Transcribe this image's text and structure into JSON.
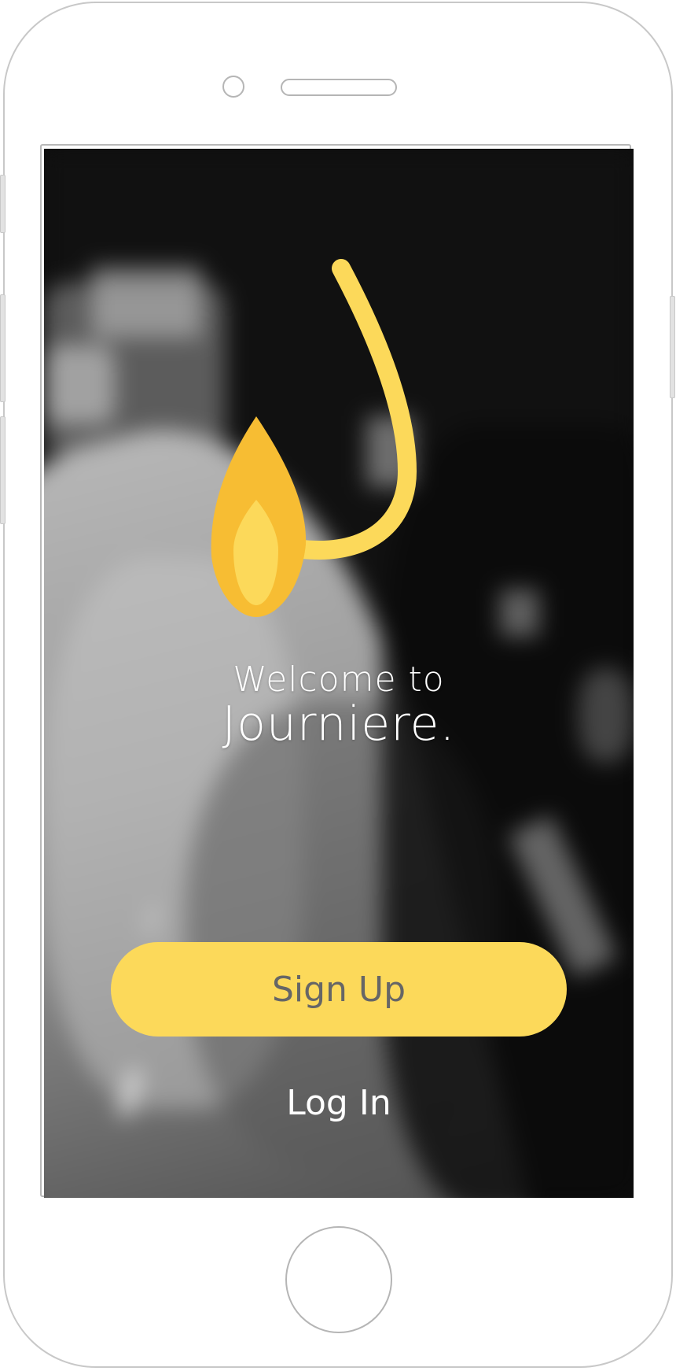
{
  "app": {
    "welcome_line": "Welcome to",
    "brand_name": "Journiere."
  },
  "actions": {
    "signup_label": "Sign Up",
    "login_label": "Log In"
  },
  "colors": {
    "accent": "#fcd95a",
    "flame_outer": "#f7bd33",
    "flame_inner": "#fcd95a",
    "signup_text": "#666666",
    "text_light": "#ffffff"
  },
  "icons": {
    "logo": "flame-drop-logo-icon"
  }
}
